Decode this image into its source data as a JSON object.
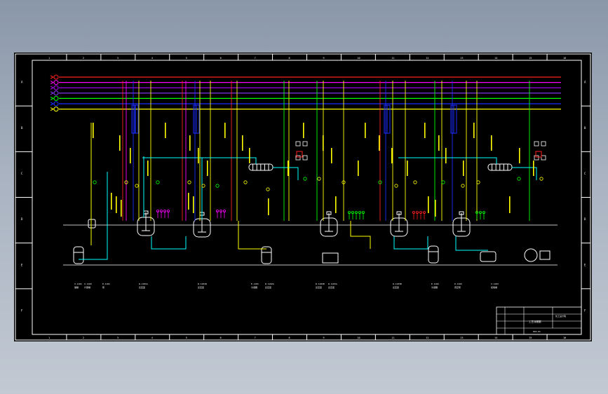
{
  "colors": {
    "background": "#000000",
    "frame": "#ffffff",
    "pipe_red": "#ff2020",
    "pipe_magenta": "#ff00ff",
    "pipe_purple": "#b400ff",
    "pipe_violet": "#8c3cff",
    "pipe_green": "#00ff00",
    "pipe_blue": "#1a2cff",
    "pipe_yellow": "#ffff00",
    "process_cyan": "#00ffff",
    "label_yellow": "#ffff00"
  },
  "header_lines": [
    "red",
    "magenta",
    "purple",
    "violet",
    "green",
    "blue",
    "yellow"
  ],
  "column_markers_top": [
    "1",
    "2",
    "3",
    "4",
    "5",
    "6",
    "7",
    "8",
    "9",
    "10",
    "11",
    "12",
    "13",
    "14",
    "15",
    "16"
  ],
  "row_markers": [
    "A",
    "B",
    "C",
    "D",
    "E",
    "F"
  ],
  "equipment_tags": [
    {
      "id": "E1",
      "tag": "V-1101",
      "desc": "储罐"
    },
    {
      "id": "E2",
      "tag": "V-1102",
      "desc": "计量罐"
    },
    {
      "id": "E3",
      "tag": "P-1101",
      "desc": "泵"
    },
    {
      "id": "E4",
      "tag": "R-1101A",
      "desc": "反应釜"
    },
    {
      "id": "E5",
      "tag": "R-1101B",
      "desc": "反应釜"
    },
    {
      "id": "E6",
      "tag": "E-1101",
      "desc": "冷凝器"
    },
    {
      "id": "E7",
      "tag": "R-1102A",
      "desc": "反应釜"
    },
    {
      "id": "E8",
      "tag": "R-1102B",
      "desc": "反应釜"
    },
    {
      "id": "E9",
      "tag": "R-1103A",
      "desc": "反应釜"
    },
    {
      "id": "E10",
      "tag": "R-1103B",
      "desc": "反应釜"
    },
    {
      "id": "E11",
      "tag": "E-1102",
      "desc": "冷凝器"
    },
    {
      "id": "E12",
      "tag": "P-1102",
      "desc": "真空泵"
    },
    {
      "id": "E13",
      "tag": "V-1103",
      "desc": "接收罐"
    }
  ],
  "title_block": {
    "drawing_title": "工艺流程图",
    "company": "化工设计院",
    "drawing_no": "PID-01"
  }
}
